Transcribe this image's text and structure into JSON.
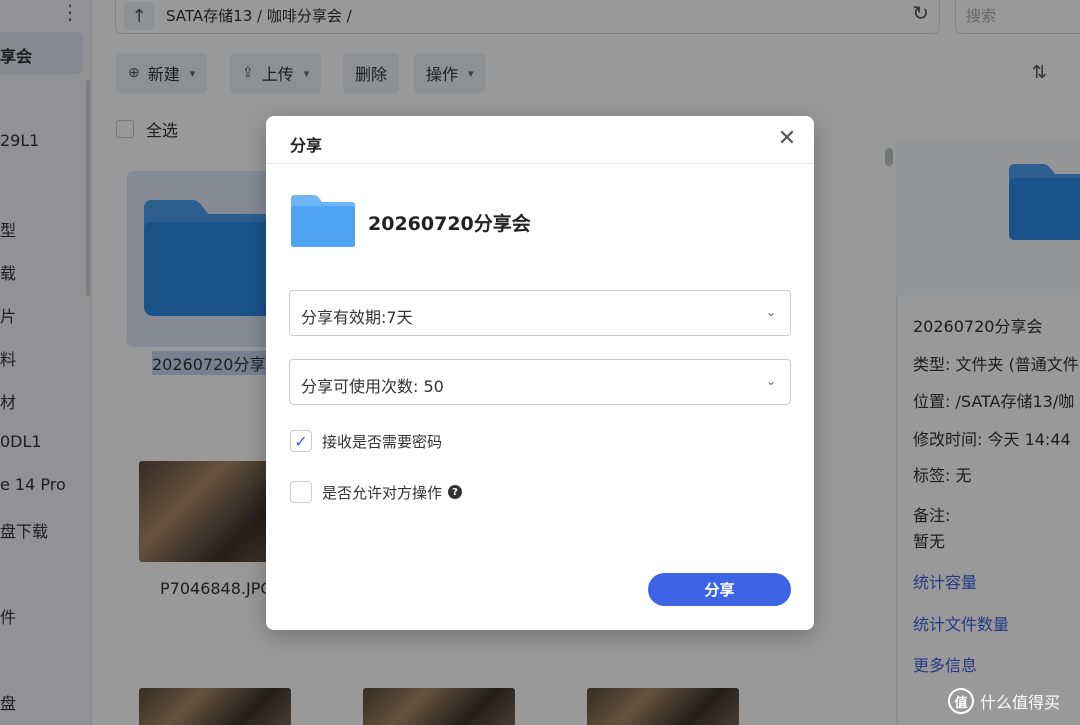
{
  "sidebar": {
    "items": [
      "享会",
      "29L1",
      "型",
      "载",
      "片",
      "料",
      "材",
      "0DL1",
      "e 14 Pro",
      "盘下载",
      "件",
      "盘"
    ]
  },
  "path": {
    "text": "SATA存储13 / 咖啡分享会 /",
    "search_placeholder": "搜索"
  },
  "toolbar": {
    "new_label": "新建",
    "upload_label": "上传",
    "delete_label": "删除",
    "action_label": "操作",
    "select_all": "全选"
  },
  "grid": {
    "folder_name": "20260720分享会",
    "photo_name": "P7046848.JPG"
  },
  "details": {
    "name": "20260720分享会",
    "type": "类型:  文件夹 (普通文件",
    "location": "位置:  /SATA存储13/咖",
    "modified": "修改时间:  今天 14:44",
    "tags": "标签:  无",
    "notes_label": "备注:",
    "notes_value": "暂无",
    "link_capacity": "统计容量",
    "link_count": "统计文件数量",
    "link_more": "更多信息"
  },
  "dialog": {
    "title": "分享",
    "folder_name": "20260720分享会",
    "validity": "分享有效期:7天",
    "usage_count": "分享可使用次数: 50",
    "require_password": "接收是否需要密码",
    "require_password_checked": true,
    "allow_operation": "是否允许对方操作",
    "allow_operation_checked": false,
    "share_button": "分享"
  },
  "watermark": {
    "text": "什么值得买",
    "logo": "值"
  },
  "colors": {
    "accent": "#3d63e6",
    "folder": "#4a9ff0"
  }
}
